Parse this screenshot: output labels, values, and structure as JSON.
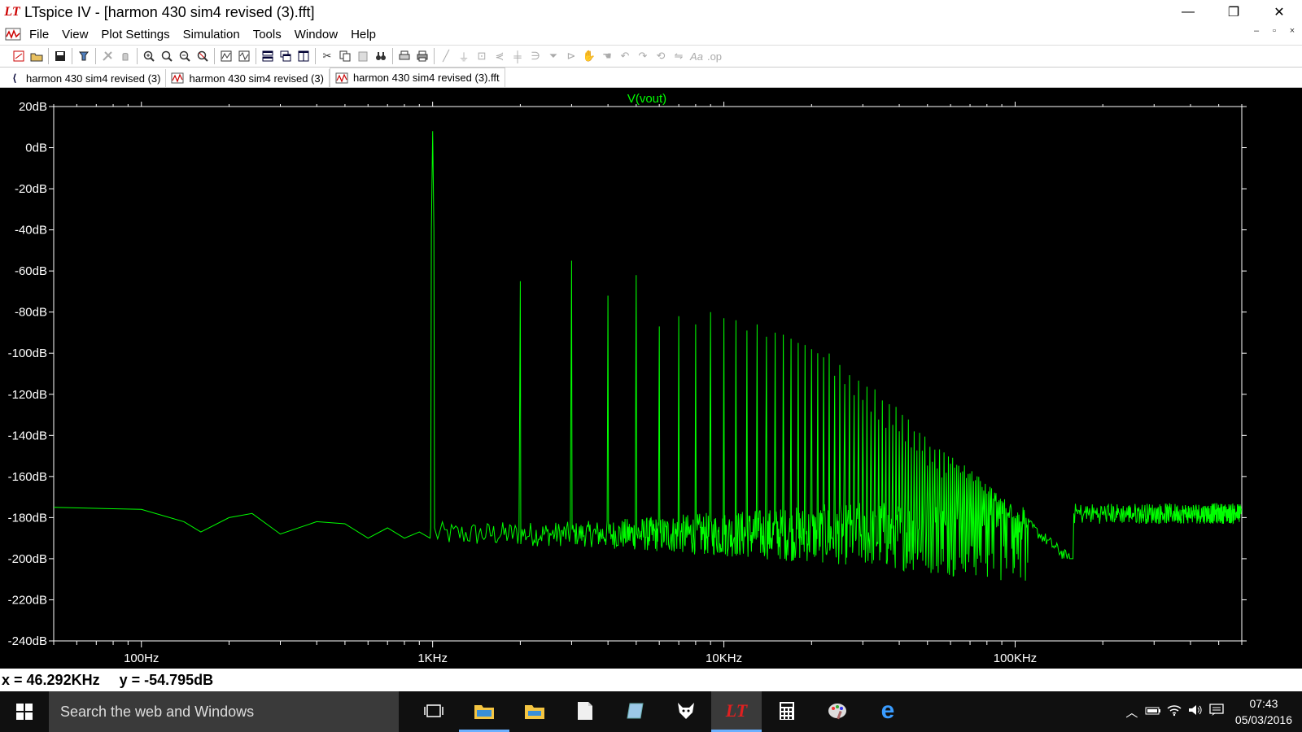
{
  "window": {
    "title": "LTspice IV - [harmon 430 sim4 revised (3).fft]",
    "logo": "LT",
    "minimize": "—",
    "restore": "❐",
    "close": "✕"
  },
  "menu": {
    "items": [
      "File",
      "View",
      "Plot Settings",
      "Simulation",
      "Tools",
      "Window",
      "Help"
    ],
    "mdi_min": "–",
    "mdi_restore": "▫",
    "mdi_close": "×"
  },
  "toolbar": {
    "icons": [
      "new-schematic-icon",
      "open-icon",
      "save-icon",
      "control-panel-icon",
      "run-icon",
      "halt-icon",
      "zoom-in-icon",
      "zoom-pan-icon",
      "zoom-out-icon",
      "zoom-fit-icon",
      "autorange-icon",
      "plot-settings-icon",
      "tile-horizontal-icon",
      "cascade-icon",
      "tile-icon",
      "cut-icon",
      "copy-icon",
      "paste-icon",
      "find-icon",
      "print-icon",
      "print-preview-icon",
      "wire-icon",
      "ground-icon",
      "label-icon",
      "resistor-icon",
      "capacitor-icon",
      "inductor-icon",
      "diode-icon",
      "component-icon",
      "move-icon",
      "drag-icon",
      "undo-icon",
      "redo-icon",
      "rotate-icon",
      "mirror-icon",
      "text-icon",
      "spice-directive-icon"
    ]
  },
  "tabs": [
    {
      "label": "harmon 430 sim4 revised (3)",
      "icon": "schematic-icon"
    },
    {
      "label": "harmon 430 sim4 revised (3)",
      "icon": "waveform-icon"
    },
    {
      "label": "harmon 430 sim4 revised (3).fft",
      "icon": "waveform-icon"
    }
  ],
  "plot": {
    "trace_name": "V(vout)",
    "trace_color": "#00ff00",
    "axis_color": "#ffffff",
    "background": "#000000"
  },
  "chart_data": {
    "type": "line",
    "title": "V(vout)",
    "xlabel": "",
    "ylabel": "",
    "x_scale": "log",
    "xlim": [
      50,
      600000
    ],
    "ylim": [
      -240,
      20
    ],
    "x_ticks": [
      "100Hz",
      "1KHz",
      "10KHz",
      "100KHz"
    ],
    "x_tick_values": [
      100,
      1000,
      10000,
      100000
    ],
    "y_ticks": [
      "20dB",
      "0dB",
      "-20dB",
      "-40dB",
      "-60dB",
      "-80dB",
      "-100dB",
      "-120dB",
      "-140dB",
      "-160dB",
      "-180dB",
      "-200dB",
      "-220dB",
      "-240dB"
    ],
    "y_tick_values": [
      20,
      0,
      -20,
      -40,
      -60,
      -80,
      -100,
      -120,
      -140,
      -160,
      -180,
      -200,
      -220,
      -240
    ],
    "series": [
      {
        "color": "#00ff00",
        "fundamental_hz": 1000,
        "fundamental_db": 8,
        "harmonic_peaks_db": [
          8,
          -65,
          -55,
          -72,
          -62,
          -87,
          -82,
          -86,
          -80,
          -83,
          -84,
          -89,
          -86,
          -92,
          -90,
          -91,
          -93,
          -95,
          -96,
          -98,
          -100,
          -102
        ],
        "noise_floor": [
          [
            50,
            -175
          ],
          [
            100,
            -176
          ],
          [
            140,
            -182
          ],
          [
            160,
            -187
          ],
          [
            200,
            -180
          ],
          [
            240,
            -178
          ],
          [
            300,
            -188
          ],
          [
            400,
            -182
          ],
          [
            500,
            -183
          ],
          [
            600,
            -190
          ],
          [
            700,
            -185
          ],
          [
            800,
            -190
          ],
          [
            900,
            -187
          ],
          [
            980,
            -190
          ]
        ]
      }
    ]
  },
  "status": {
    "x_readout": "x = 46.292KHz",
    "y_readout": "y = -54.795dB"
  },
  "taskbar": {
    "search_placeholder": "Search the web and Windows",
    "time": "07:43",
    "date": "05/03/2016"
  }
}
